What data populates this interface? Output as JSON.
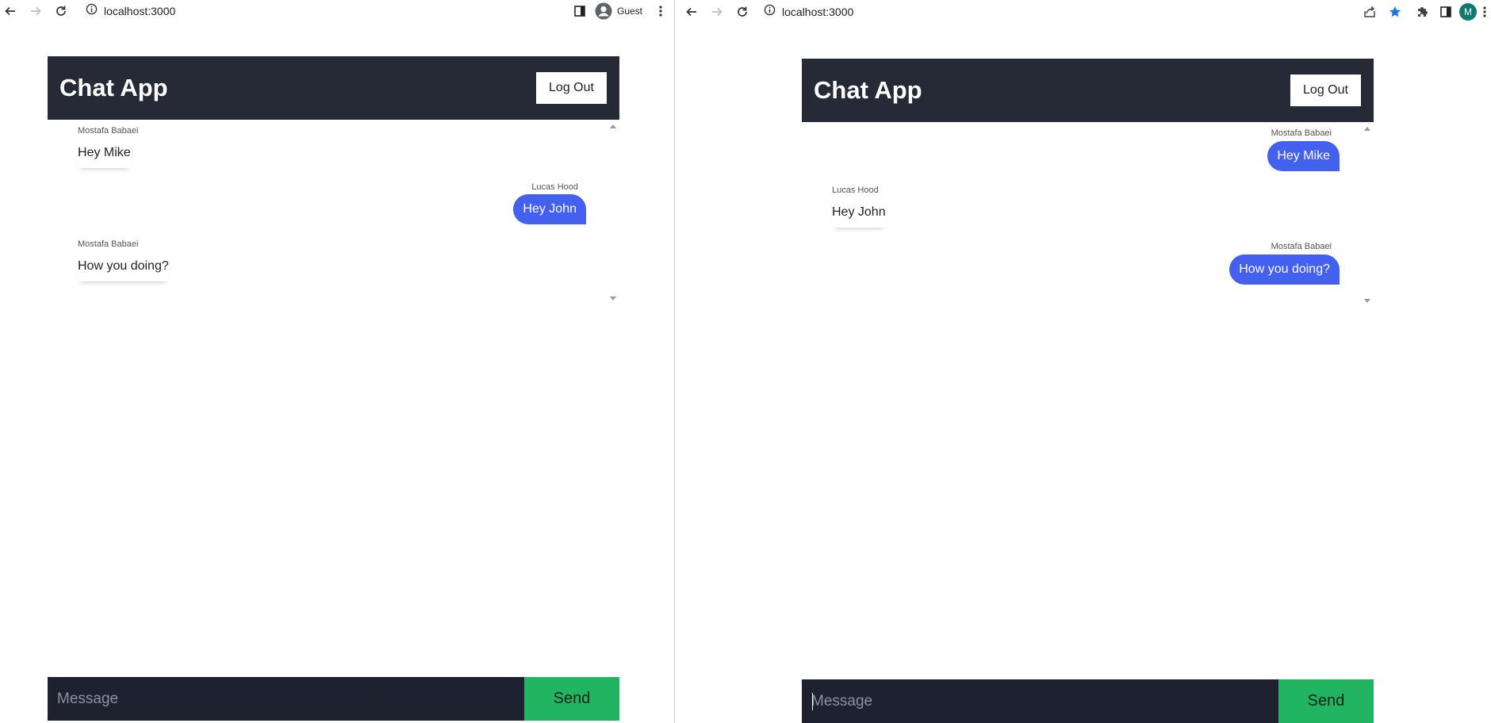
{
  "left_window": {
    "url": "localhost:3000",
    "profile_label": "Guest",
    "app": {
      "title": "Chat App",
      "logout_label": "Log Out",
      "messages": [
        {
          "sender": "Mostafa Babaei",
          "text": "Hey Mike",
          "side": "left"
        },
        {
          "sender": "Lucas Hood",
          "text": "Hey John",
          "side": "right"
        },
        {
          "sender": "Mostafa Babaei",
          "text": "How you doing?",
          "side": "left"
        }
      ],
      "input_placeholder": "Message",
      "send_label": "Send"
    }
  },
  "right_window": {
    "url": "localhost:3000",
    "profile_initial": "M",
    "app": {
      "title": "Chat App",
      "logout_label": "Log Out",
      "messages": [
        {
          "sender": "Mostafa Babaei",
          "text": "Hey Mike",
          "side": "right"
        },
        {
          "sender": "Lucas Hood",
          "text": "Hey John",
          "side": "left"
        },
        {
          "sender": "Mostafa Babaei",
          "text": "How you doing?",
          "side": "right"
        }
      ],
      "input_placeholder": "Message",
      "send_label": "Send"
    }
  },
  "colors": {
    "header_bg": "#252a36",
    "bubble_blue": "#4361ee",
    "input_bg": "#1e2230",
    "send_green": "#21b562",
    "profile_avatar": "#0f7a6b",
    "bookmark_star": "#1a73e8"
  },
  "icons": [
    "back-arrow-icon",
    "forward-arrow-icon",
    "reload-icon",
    "info-icon",
    "sidebar-icon",
    "profile-icon",
    "kebab-menu-icon",
    "share-icon",
    "bookmark-star-icon",
    "extensions-puzzle-icon",
    "text-cursor-icon"
  ]
}
